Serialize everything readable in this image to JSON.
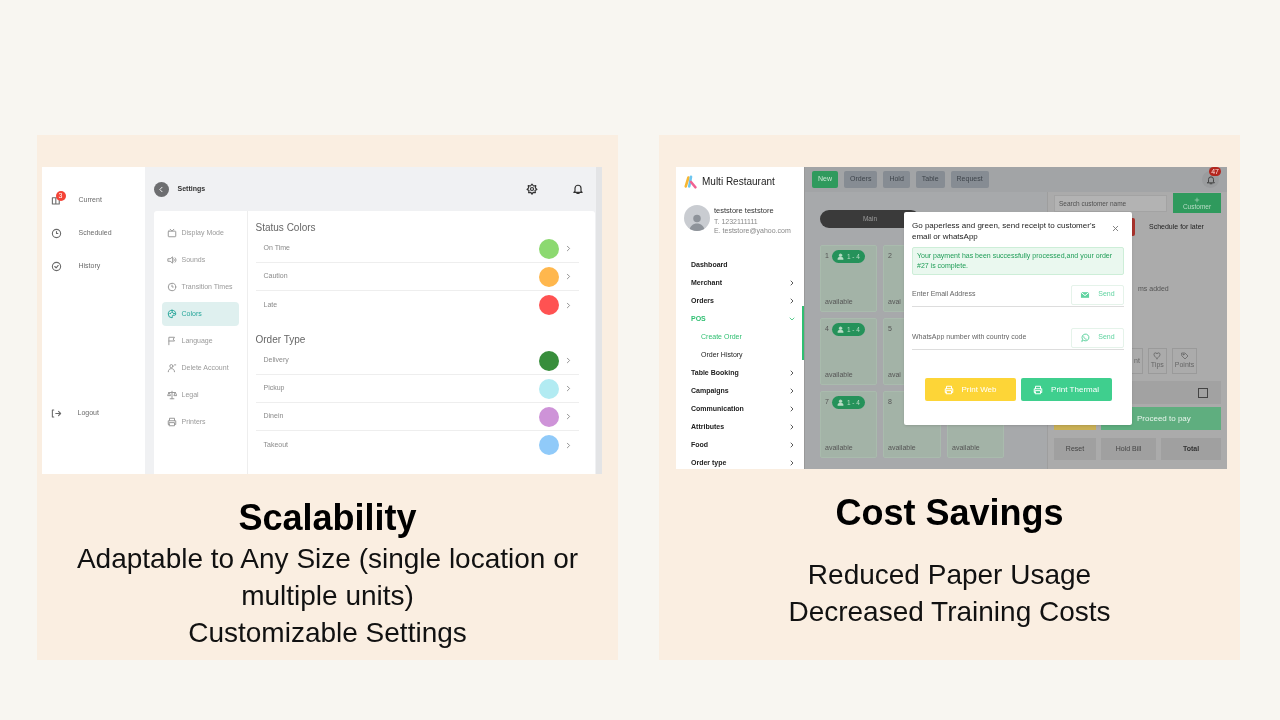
{
  "panels": [
    {
      "kind": "settings",
      "title": "Scalability",
      "lines": [
        "Adaptable to Any Size (single location or multiple units)",
        "Customizable Settings"
      ],
      "app": {
        "sidebar": [
          {
            "label": "Current",
            "badge": "3"
          },
          {
            "label": "Scheduled"
          },
          {
            "label": "History"
          }
        ],
        "logout": "Logout",
        "header": "Settings",
        "nav": [
          {
            "label": "Display Mode",
            "selected": false
          },
          {
            "label": "Sounds",
            "selected": false
          },
          {
            "label": "Transition Times",
            "selected": false
          },
          {
            "label": "Colors",
            "selected": true
          },
          {
            "label": "Language",
            "selected": false
          },
          {
            "label": "Delete Account",
            "selected": false
          },
          {
            "label": "Legal",
            "selected": false
          },
          {
            "label": "Printers",
            "selected": false
          }
        ],
        "sections": [
          {
            "title": "Status Colors",
            "items": [
              {
                "label": "On Time",
                "color": "#8cd970"
              },
              {
                "label": "Caution",
                "color": "#ffb74d"
              },
              {
                "label": "Late",
                "color": "#ff5252"
              }
            ]
          },
          {
            "title": "Order Type",
            "items": [
              {
                "label": "Delivery",
                "color": "#388e3c"
              },
              {
                "label": "Pickup",
                "color": "#b2ebf2"
              },
              {
                "label": "Dinein",
                "color": "#ce93d8"
              },
              {
                "label": "Takeout",
                "color": "#90caf9"
              }
            ]
          }
        ]
      }
    },
    {
      "kind": "pos",
      "title": "Cost Savings",
      "lines": [
        "Reduced Paper Usage",
        "Decreased Training Costs"
      ],
      "app": {
        "brand": "Multi Restaurant",
        "profile": {
          "name": "teststore teststore",
          "phone": "T. 1232111111",
          "email": "E. teststore@yahoo.com"
        },
        "nav": [
          {
            "label": "Dashboard",
            "kind": "link",
            "selected": false
          },
          {
            "label": "Merchant",
            "kind": "group",
            "expanded": false,
            "selected": false
          },
          {
            "label": "Orders",
            "kind": "group",
            "expanded": false,
            "selected": false
          },
          {
            "label": "POS",
            "kind": "group",
            "expanded": true,
            "selected": true,
            "children": [
              {
                "label": "Create Order",
                "selected": true
              },
              {
                "label": "Order History",
                "selected": false
              }
            ]
          },
          {
            "label": "Table Booking",
            "kind": "group",
            "expanded": false,
            "selected": false
          },
          {
            "label": "Campaigns",
            "kind": "group",
            "expanded": false,
            "selected": false
          },
          {
            "label": "Communication",
            "kind": "group",
            "expanded": false,
            "selected": false
          },
          {
            "label": "Attributes",
            "kind": "group",
            "expanded": false,
            "selected": false
          },
          {
            "label": "Food",
            "kind": "group",
            "expanded": false,
            "selected": false
          },
          {
            "label": "Order type",
            "kind": "group",
            "expanded": false,
            "selected": false
          }
        ],
        "toolbar": [
          {
            "label": "New",
            "selected": true
          },
          {
            "label": "Orders",
            "selected": false
          },
          {
            "label": "Hold",
            "selected": false
          },
          {
            "label": "Table",
            "selected": false
          },
          {
            "label": "Request",
            "selected": false
          }
        ],
        "notifications": "47",
        "floor": "Main",
        "tables": [
          {
            "number": "1",
            "seats": "1 - 4",
            "status": "available"
          },
          {
            "number": "2",
            "status": "avai"
          },
          {
            "number": "4",
            "seats": "1 - 4",
            "status": "available"
          },
          {
            "number": "5",
            "status": "avai"
          },
          {
            "number": "7",
            "seats": "1 - 4",
            "status": "available"
          },
          {
            "number": "8",
            "status": "available"
          },
          {
            "status": "available"
          }
        ],
        "customer": {
          "placeholder": "Search customer name",
          "add": "Customer",
          "schedule": "Schedule for later",
          "empty": "ms added",
          "tools": [
            "nt",
            "Tips",
            "Points"
          ],
          "checked": false,
          "proceed": "Proceed to pay",
          "actions": [
            "Reset",
            "Hold Bill",
            "Total"
          ]
        },
        "modal": {
          "title": "Go paperless and green, send receipt to customer's email or whatsApp",
          "alert": "Your payment has been successfully processed,and your order #27 is complete.",
          "fields": [
            {
              "kind": "email",
              "placeholder": "Enter Email Address",
              "action": "Send"
            },
            {
              "kind": "whatsapp",
              "placeholder": "WhatsApp number with country code",
              "action": "Send"
            }
          ],
          "buttons": [
            {
              "kind": "web",
              "label": "Print Web"
            },
            {
              "kind": "thermal",
              "label": "Print Thermal"
            }
          ]
        }
      }
    }
  ]
}
